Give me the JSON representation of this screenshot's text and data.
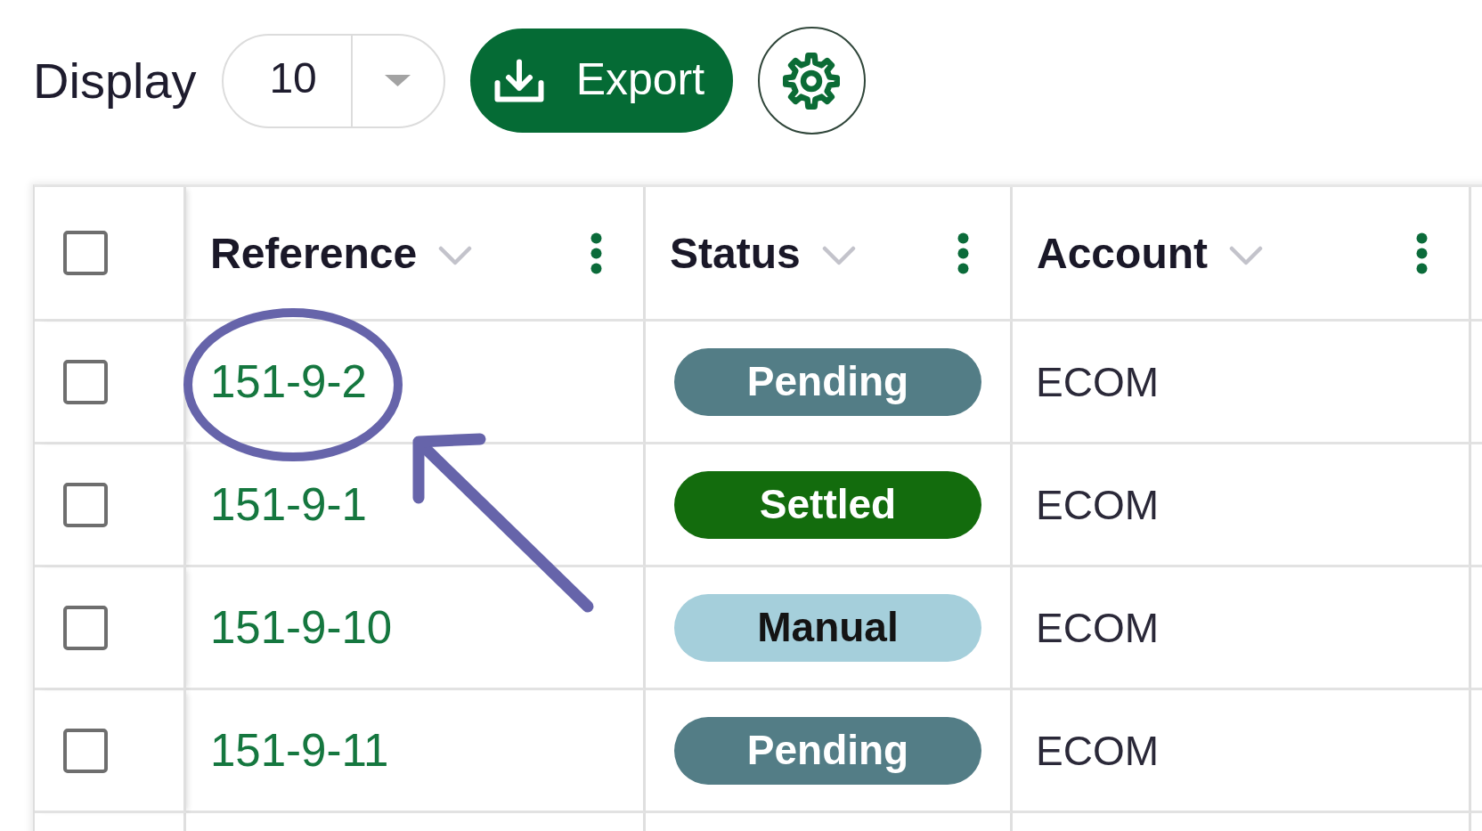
{
  "toolbar": {
    "display_label": "Display",
    "page_size": "10",
    "export_label": "Export"
  },
  "table": {
    "select_all": {
      "checked": false
    },
    "columns": [
      {
        "label": "Reference"
      },
      {
        "label": "Status"
      },
      {
        "label": "Account"
      }
    ],
    "rows": [
      {
        "checked": false,
        "circled": true,
        "reference": "151-9-2",
        "status": {
          "label": "Pending",
          "color": "#537d86"
        },
        "account": "ECOM"
      },
      {
        "checked": false,
        "circled": false,
        "reference": "151-9-1",
        "status": {
          "label": "Settled",
          "color": "#136c0d"
        },
        "account": "ECOM"
      },
      {
        "checked": false,
        "circled": false,
        "reference": "151-9-10",
        "status": {
          "label": "Manual",
          "color": "#a5cfdb"
        },
        "account": "ECOM"
      },
      {
        "checked": false,
        "circled": false,
        "reference": "151-9-11",
        "status": {
          "label": "Pending",
          "color": "#537d86"
        },
        "account": "ECOM"
      }
    ]
  }
}
